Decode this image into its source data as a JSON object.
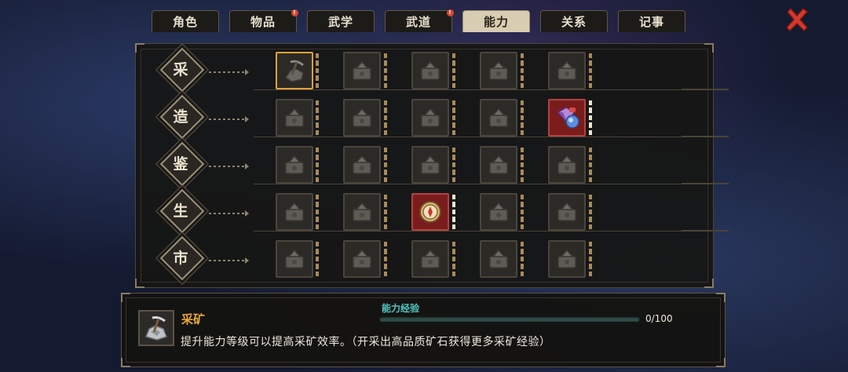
{
  "tabs": [
    {
      "label": "角色",
      "badge": false,
      "active": false
    },
    {
      "label": "物品",
      "badge": true,
      "active": false
    },
    {
      "label": "武学",
      "badge": false,
      "active": false
    },
    {
      "label": "武道",
      "badge": true,
      "active": false
    },
    {
      "label": "能力",
      "badge": false,
      "active": true
    },
    {
      "label": "关系",
      "badge": false,
      "active": false
    },
    {
      "label": "记事",
      "badge": false,
      "active": false
    }
  ],
  "badge_mark": "!",
  "close_icon": "close-x-icon",
  "categories": [
    {
      "label": "采",
      "skills": [
        {
          "icon": "pickaxe-icon",
          "state": "selected"
        },
        {
          "icon": "axe-log-icon",
          "state": "locked"
        },
        {
          "icon": "herb-basket-icon",
          "state": "locked"
        },
        {
          "icon": "fishing-rod-icon",
          "state": "locked"
        },
        {
          "icon": "bucket-icon",
          "state": "locked"
        }
      ]
    },
    {
      "label": "造",
      "skills": [
        {
          "icon": "anvil-icon",
          "state": "locked"
        },
        {
          "icon": "stone-pile-icon",
          "state": "locked"
        },
        {
          "icon": "weaving-icon",
          "state": "locked"
        },
        {
          "icon": "mortar-icon",
          "state": "locked"
        },
        {
          "icon": "gem-potion-icon",
          "state": "unlocked"
        }
      ]
    },
    {
      "label": "鉴",
      "skills": [
        {
          "icon": "magnifier-cloth-icon",
          "state": "locked"
        },
        {
          "icon": "scroll-lens-icon",
          "state": "locked"
        },
        {
          "icon": "lens-crate-icon",
          "state": "locked"
        },
        {
          "icon": "skull-lens-icon",
          "state": "locked"
        },
        {
          "icon": "lens-box-icon",
          "state": "locked"
        }
      ]
    },
    {
      "label": "生",
      "skills": [
        {
          "icon": "steamer-icon",
          "state": "locked"
        },
        {
          "icon": "abacus-icon",
          "state": "locked"
        },
        {
          "icon": "compass-icon",
          "state": "unlocked"
        },
        {
          "icon": "map-icon",
          "state": "locked"
        },
        {
          "icon": "rope-coil-icon",
          "state": "locked"
        }
      ]
    },
    {
      "label": "市",
      "skills": [
        {
          "icon": "money-bag-icon",
          "state": "locked"
        },
        {
          "icon": "handshake-icon",
          "state": "locked"
        },
        {
          "icon": "mushroom-icon",
          "state": "locked"
        },
        {
          "icon": "gear-bag-icon",
          "state": "locked"
        },
        {
          "icon": "horn-icon",
          "state": "locked"
        }
      ]
    }
  ],
  "info": {
    "icon": "ore-pickaxe-icon",
    "title": "采矿",
    "description": "提升能力等级可以提高采矿效率。（开采出高品质矿石获得更多采矿经验）",
    "exp_label": "能力经验",
    "exp_value": "0/100",
    "exp_fraction": 0
  },
  "colors": {
    "selected_border": "#e7a23a",
    "unlocked_bg": "#7a1c1c",
    "exp_fill": "#4fc7c1",
    "info_title": "#e8a93a",
    "close_red": "#d43a2c"
  }
}
